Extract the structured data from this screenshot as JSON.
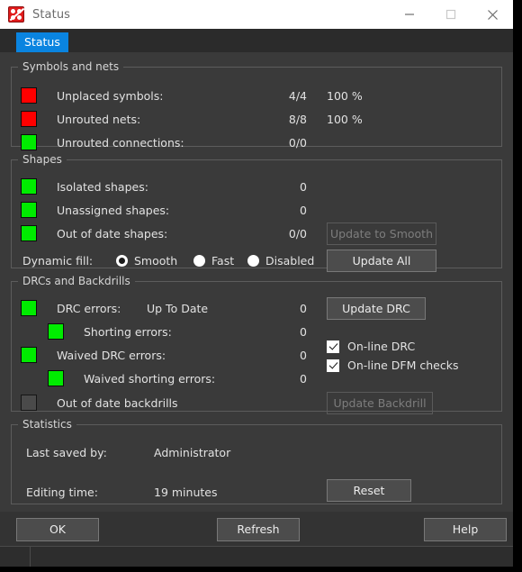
{
  "window": {
    "title": "Status",
    "icon": "status-app-icon",
    "controls": {
      "minimize": "minimize-icon",
      "maximize": "maximize-icon",
      "close": "close-icon"
    }
  },
  "tabs": [
    {
      "label": "Status",
      "selected": true
    }
  ],
  "groups": {
    "symbols_and_nets": {
      "title": "Symbols and nets",
      "rows": [
        {
          "indicator": "red",
          "label": "Unplaced symbols:",
          "value": "4/4",
          "percent": "100 %"
        },
        {
          "indicator": "red",
          "label": "Unrouted nets:",
          "value": "8/8",
          "percent": "100 %"
        },
        {
          "indicator": "green",
          "label": "Unrouted connections:",
          "value": "0/0",
          "percent": ""
        }
      ]
    },
    "shapes": {
      "title": "Shapes",
      "rows": [
        {
          "indicator": "green",
          "label": "Isolated shapes:",
          "value": "0",
          "button": ""
        },
        {
          "indicator": "green",
          "label": "Unassigned shapes:",
          "value": "0",
          "button": ""
        },
        {
          "indicator": "green",
          "label": "Out of date shapes:",
          "value": "0/0",
          "button": "Update to Smooth",
          "button_disabled": true
        }
      ],
      "dynamic_fill": {
        "label": "Dynamic fill:",
        "options": [
          {
            "label": "Smooth",
            "selected": true
          },
          {
            "label": "Fast",
            "selected": false
          },
          {
            "label": "Disabled",
            "selected": false
          }
        ]
      },
      "update_all_button": "Update All"
    },
    "drcs_and_backdrills": {
      "title": "DRCs and Backdrills",
      "rows": [
        {
          "indicator": "green",
          "label": "DRC errors:",
          "state": "Up To Date",
          "value": "0",
          "indent": 0
        },
        {
          "indicator": "green",
          "label": "Shorting errors:",
          "state": "",
          "value": "0",
          "indent": 1
        },
        {
          "indicator": "green",
          "label": "Waived DRC errors:",
          "state": "",
          "value": "0",
          "indent": 0
        },
        {
          "indicator": "green",
          "label": "Waived shorting errors:",
          "state": "",
          "value": "0",
          "indent": 1
        },
        {
          "indicator": "off",
          "label": "Out of date backdrills",
          "state": "",
          "value": "",
          "indent": 0
        }
      ],
      "update_drc_button": "Update DRC",
      "update_backdrill_button": "Update Backdrill",
      "checkboxes": [
        {
          "label": "On-line DRC",
          "checked": true
        },
        {
          "label": "On-line DFM checks",
          "checked": true
        }
      ]
    },
    "statistics": {
      "title": "Statistics",
      "rows": [
        {
          "key": "Last saved by:",
          "value": "Administrator"
        },
        {
          "key": "Editing time:",
          "value": "19 minutes"
        }
      ],
      "reset_button": "Reset"
    }
  },
  "footer": {
    "ok": "OK",
    "refresh": "Refresh",
    "help": "Help"
  },
  "colors": {
    "window_bg": "#3a3a3a",
    "titlebar_bg": "#ffffff",
    "tab_accent": "#0a84e0",
    "indicator_error": "#ff0000",
    "indicator_ok": "#00ec00",
    "indicator_off": "#4a4a4a",
    "text": "#e2e2e2"
  }
}
